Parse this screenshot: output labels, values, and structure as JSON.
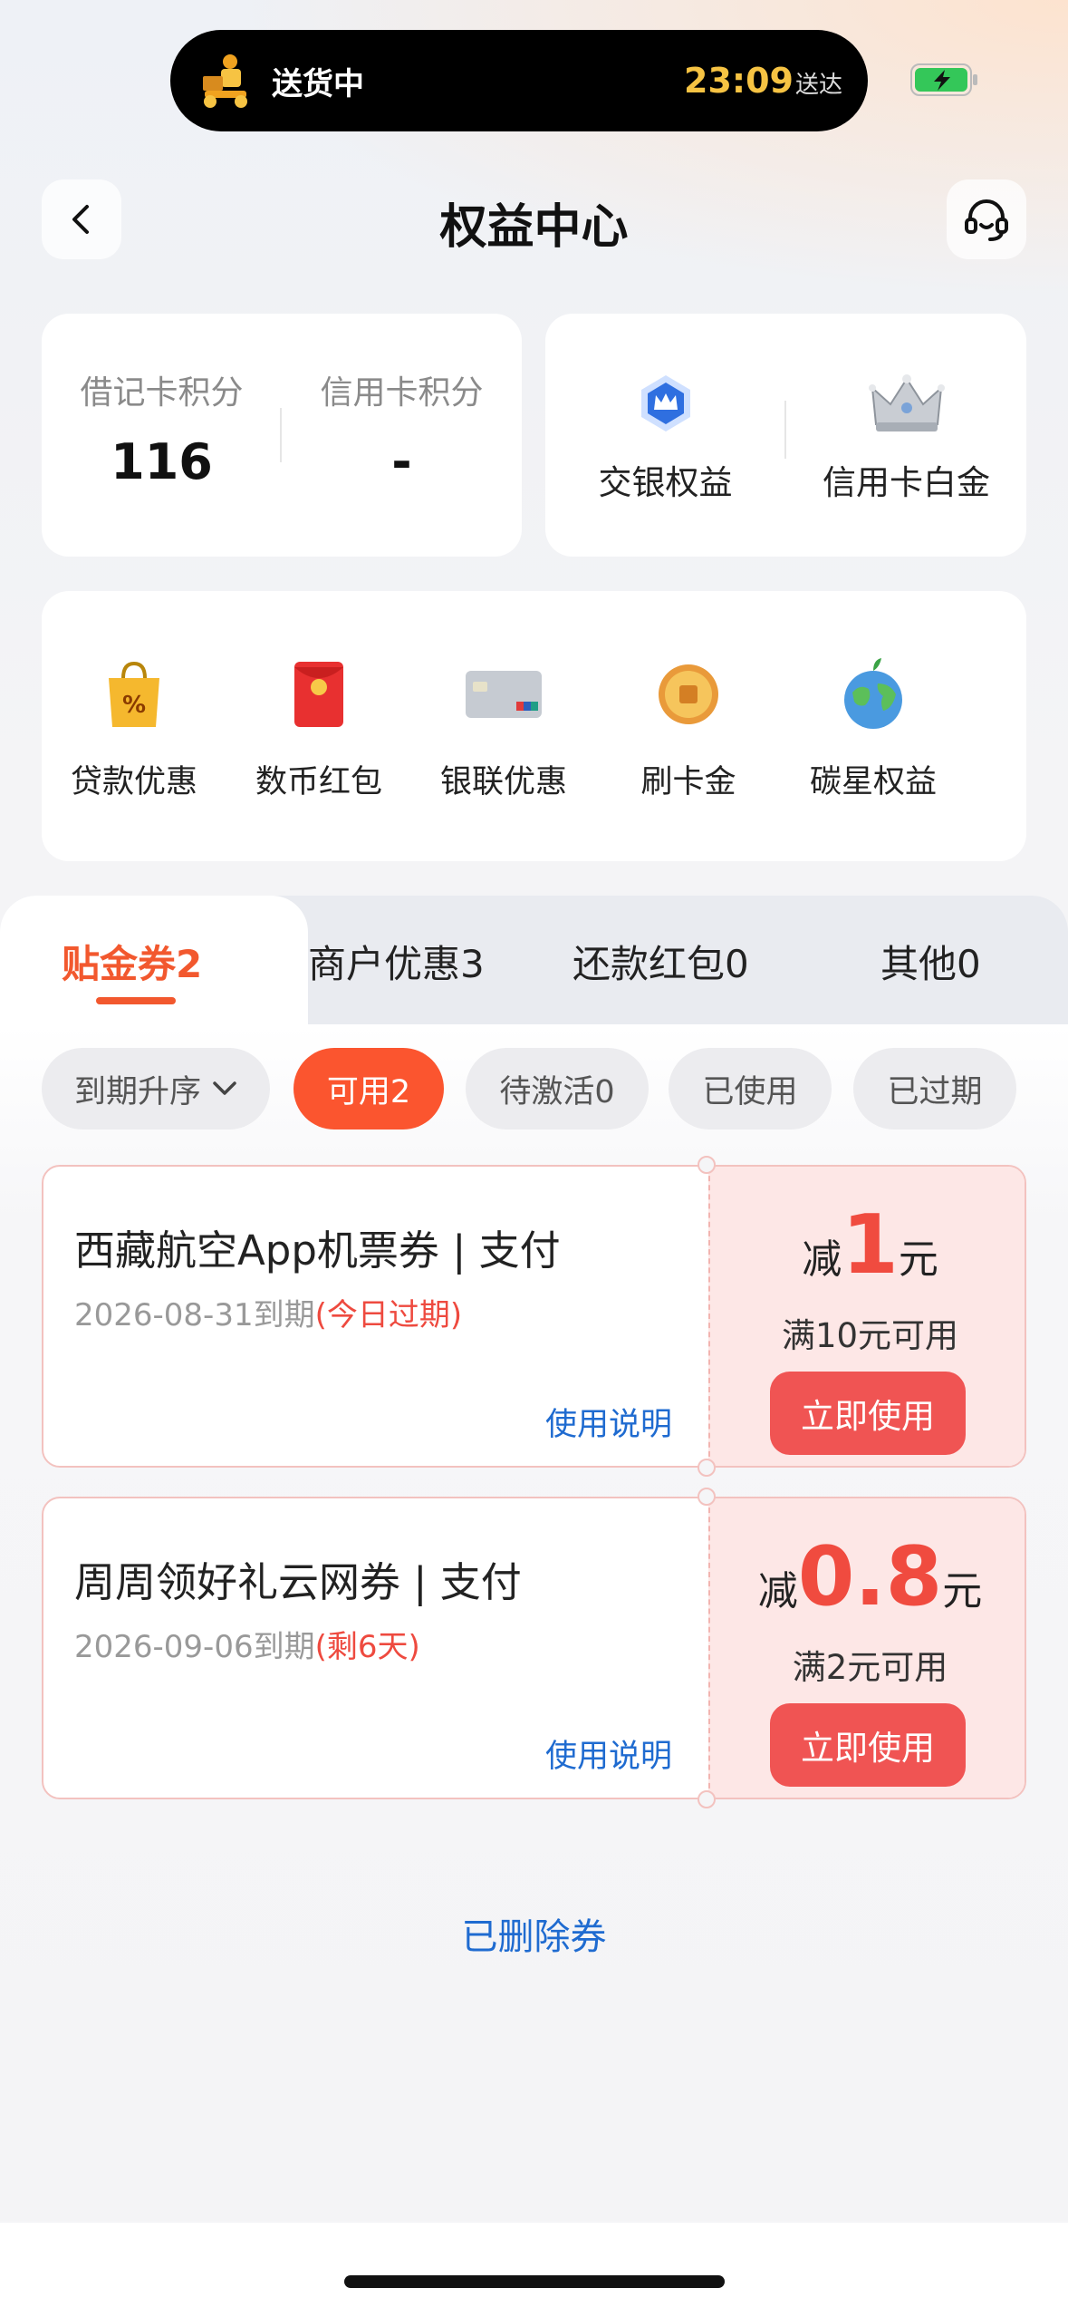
{
  "status_bar": {
    "delivery_status": "送货中",
    "eta_time": "23:09",
    "eta_suffix": "送达"
  },
  "header": {
    "title": "权益中心"
  },
  "points": {
    "debit_label": "借记卡积分",
    "debit_value": "116",
    "credit_label": "信用卡积分",
    "credit_value": "-"
  },
  "rights": {
    "bocom_label": "交银权益",
    "platinum_label": "信用卡白金"
  },
  "shortcuts": [
    {
      "label": "贷款优惠",
      "icon": "shopping-bag-icon"
    },
    {
      "label": "数币红包",
      "icon": "red-envelope-icon"
    },
    {
      "label": "银联优惠",
      "icon": "bank-card-icon"
    },
    {
      "label": "刷卡金",
      "icon": "coin-icon"
    },
    {
      "label": "碳星权益",
      "icon": "earth-icon"
    }
  ],
  "tabs": [
    {
      "label": "贴金券2",
      "active": true
    },
    {
      "label": "商户优惠3",
      "active": false
    },
    {
      "label": "还款红包0",
      "active": false
    },
    {
      "label": "其他0",
      "active": false
    }
  ],
  "filters": {
    "sort": "到期升序",
    "chips": [
      "可用2",
      "待激活0",
      "已使用",
      "已过期"
    ],
    "active": "可用2"
  },
  "coupons": [
    {
      "title": "西藏航空App机票券 | 支付",
      "expiry": "2026-08-31到期",
      "expiry_note": "(今日过期)",
      "usage_link": "使用说明",
      "discount_prefix": "减",
      "discount_amount": "1",
      "discount_unit": "元",
      "condition": "满10元可用",
      "button": "立即使用"
    },
    {
      "title": "周周领好礼云网券 | 支付",
      "expiry": "2026-09-06到期",
      "expiry_note": "(剩6天)",
      "usage_link": "使用说明",
      "discount_prefix": "减",
      "discount_amount": "0.8",
      "discount_unit": "元",
      "condition": "满2元可用",
      "button": "立即使用"
    }
  ],
  "footer": {
    "deleted_link": "已删除券"
  },
  "colors": {
    "accent": "#f2582e",
    "chip_active": "#fb552f",
    "coupon_button": "#f05453",
    "link": "#1f6bd0",
    "eta": "#f6c343"
  }
}
